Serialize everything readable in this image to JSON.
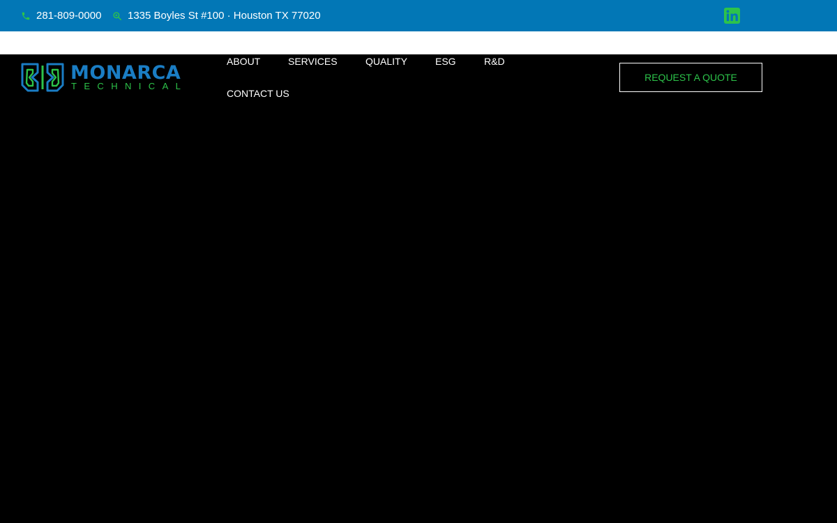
{
  "topbar": {
    "background": "#0277b6",
    "phone": "281-809-0000",
    "address": "1335 Boyles St #100 · Houston TX 77020",
    "phone_icon": "phone-icon",
    "address_icon": "location-icon",
    "social_icon": "linkedin-icon",
    "icon_color": "#2dc34a"
  },
  "brand": {
    "name": "MONARCA",
    "tagline": "TECHNICAL",
    "primary_color": "#1a7dc4",
    "accent_color": "#2dc34a"
  },
  "nav": {
    "items": [
      {
        "label": "ABOUT"
      },
      {
        "label": "SERVICES"
      },
      {
        "label": "QUALITY"
      },
      {
        "label": "ESG"
      },
      {
        "label": "R&D"
      },
      {
        "label": "CONTACT US"
      }
    ],
    "cta_label": "REQUEST A QUOTE"
  }
}
